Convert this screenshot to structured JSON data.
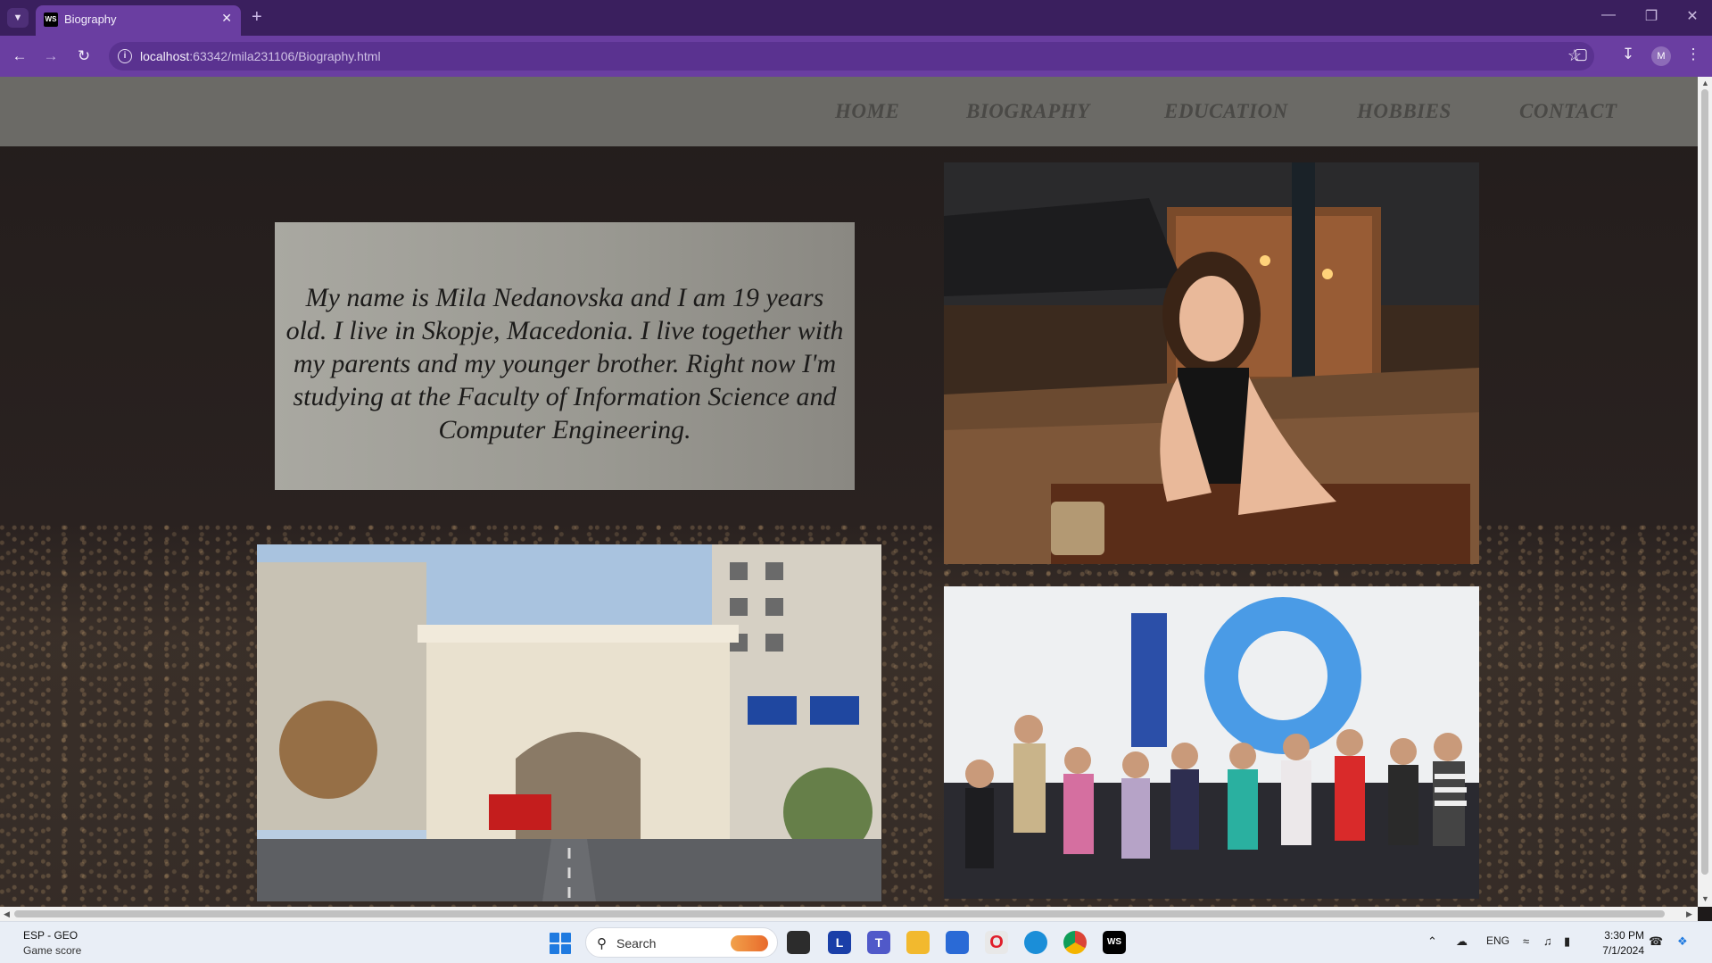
{
  "browser": {
    "tab_title": "Biography",
    "tab_favicon": "WS",
    "url_host": "localhost",
    "url_path": ":63342/mila231106/Biography.html",
    "profile_initial": "M"
  },
  "site": {
    "nav": [
      {
        "label": "HOME"
      },
      {
        "label": "BIOGRAPHY"
      },
      {
        "label": "EDUCATION"
      },
      {
        "label": "HOBBIES"
      },
      {
        "label": "CONTACT"
      }
    ],
    "bio": "My name is Mila Nedanovska and I am 19 years old. I live in Skopje, Macedonia. I live together with my parents and my younger brother. Right now I'm studying at the Faculty of Information Science and Computer Engineering.",
    "photos": [
      {
        "name": "portrait-photo"
      },
      {
        "name": "skopje-gate-photo"
      },
      {
        "name": "students-photo"
      }
    ],
    "colors": {
      "navbar": "#6b6a66",
      "nav_text": "#4a4946",
      "bio_box": "#a9a8a1",
      "page_bg": "#231d1c"
    }
  },
  "taskbar": {
    "widget_title": "ESP - GEO",
    "widget_subtitle": "Game score",
    "search_label": "Search",
    "language": "ENG",
    "time": "3:30 PM",
    "date": "7/1/2024",
    "apps": [
      "file-explorer",
      "l-app",
      "teams",
      "folder",
      "store",
      "opera",
      "edge",
      "chrome",
      "webstorm"
    ]
  }
}
